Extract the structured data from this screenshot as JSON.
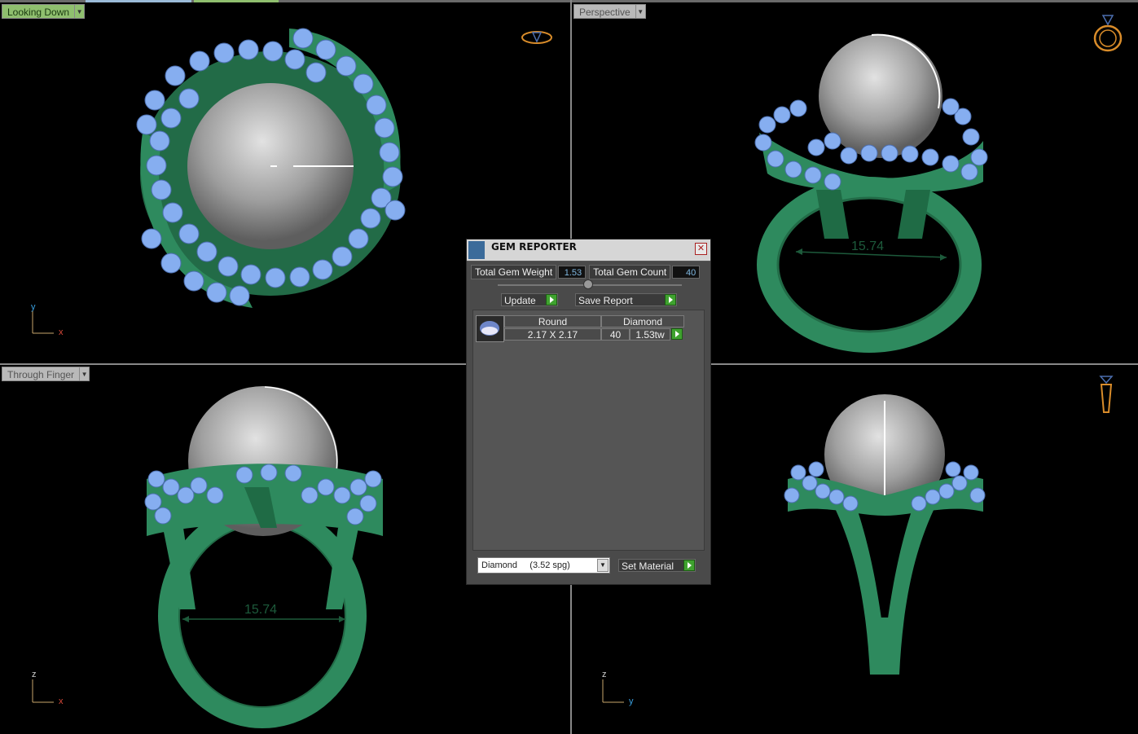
{
  "viewports": {
    "top_left": {
      "label": "Looking Down",
      "axis1": "y",
      "axis2": "x"
    },
    "top_right": {
      "label": "Perspective",
      "measure": "15.74"
    },
    "bottom_left": {
      "label": "Through Finger",
      "axis1": "z",
      "axis2": "x",
      "measure": "15.74"
    },
    "bottom_right": {
      "axis1": "z",
      "axis2": "y"
    }
  },
  "icons": [
    "ring-top-view-icon",
    "ring-perspective-icon",
    "ring-side-view-icon",
    "dropdown-arrow-icon",
    "gem-reporter-icon",
    "close-icon",
    "go-arrow-icon",
    "round-gem-icon"
  ],
  "gem_reporter": {
    "title": "GEM REPORTER",
    "close": "✕",
    "total_weight_label": "Total Gem Weight",
    "total_weight": "1.53",
    "total_count_label": "Total Gem Count",
    "total_count": "40",
    "update_label": "Update",
    "save_label": "Save Report",
    "table": {
      "shape": "Round",
      "material": "Diamond",
      "size": "2.17 X 2.17",
      "count": "40",
      "weight": "1.53tw"
    },
    "material_select": "Diamond     (3.52 spg)",
    "set_material_label": "Set Material"
  },
  "colors": {
    "metal": "#2e8a5e",
    "gem": "#86aef0",
    "pearl": "#b5b5b5",
    "accent_green": "#8fbf6e",
    "go_button": "#3fa22f"
  }
}
